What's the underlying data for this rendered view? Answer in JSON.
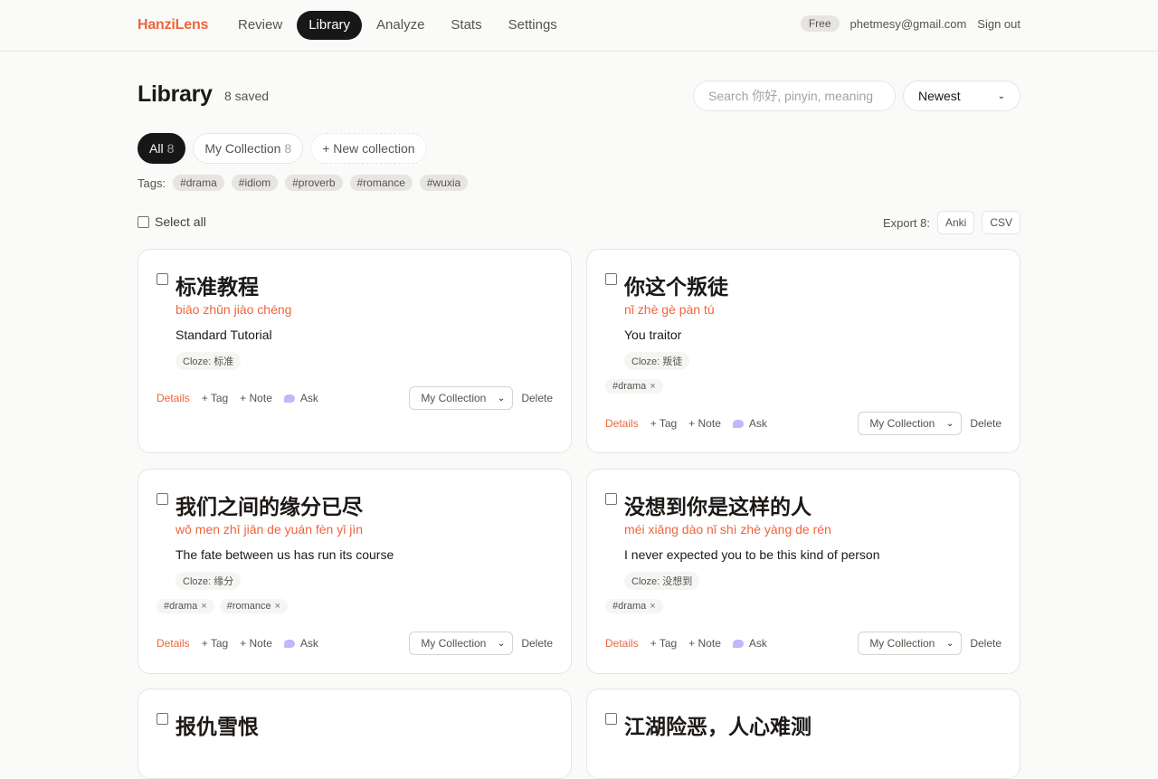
{
  "app": {
    "brand": "HanziLens"
  },
  "nav": [
    {
      "label": "Review",
      "active": false
    },
    {
      "label": "Library",
      "active": true
    },
    {
      "label": "Analyze",
      "active": false
    },
    {
      "label": "Stats",
      "active": false
    },
    {
      "label": "Settings",
      "active": false
    }
  ],
  "account": {
    "plan": "Free",
    "email": "phetmesy@gmail.com",
    "sign_out": "Sign out"
  },
  "page": {
    "title": "Library",
    "saved": "8 saved"
  },
  "search": {
    "placeholder": "Search 你好, pinyin, meaning",
    "value": ""
  },
  "sort": {
    "selected": "Newest"
  },
  "collections": {
    "all_label": "All",
    "all_count": "8",
    "my_label": "My Collection",
    "my_count": "8",
    "new_label": "+ New collection"
  },
  "tags": {
    "label": "Tags:",
    "items": [
      "#drama",
      "#idiom",
      "#proverb",
      "#romance",
      "#wuxia"
    ]
  },
  "select_all": "Select all",
  "export": {
    "label": "Export 8:",
    "anki": "Anki",
    "csv": "CSV"
  },
  "card_actions": {
    "details": "Details",
    "tag": "+ Tag",
    "note": "+ Note",
    "ask": "Ask",
    "collection": "My Collection",
    "delete": "Delete"
  },
  "cards": [
    {
      "hanzi": "标准教程",
      "pinyin": "biāo zhǔn jiào chéng",
      "meaning": "Standard Tutorial",
      "cloze": "Cloze: 标准",
      "tags": []
    },
    {
      "hanzi": "你这个叛徒",
      "pinyin": "nǐ zhè gè pàn tú",
      "meaning": "You traitor",
      "cloze": "Cloze: 叛徒",
      "tags": [
        "#drama"
      ]
    },
    {
      "hanzi": "我们之间的缘分已尽",
      "pinyin": "wǒ men zhī jiān de yuán fèn yǐ jìn",
      "meaning": "The fate between us has run its course",
      "cloze": "Cloze: 缘分",
      "tags": [
        "#drama",
        "#romance"
      ]
    },
    {
      "hanzi": "没想到你是这样的人",
      "pinyin": "méi xiǎng dào nǐ shì zhè yàng de rén",
      "meaning": "I never expected you to be this kind of person",
      "cloze": "Cloze: 没想到",
      "tags": [
        "#drama"
      ]
    },
    {
      "hanzi": "报仇雪恨",
      "pinyin": "",
      "meaning": "",
      "cloze": "",
      "tags": []
    },
    {
      "hanzi": "江湖险恶，人心难测",
      "pinyin": "",
      "meaning": "",
      "cloze": "",
      "tags": []
    }
  ]
}
